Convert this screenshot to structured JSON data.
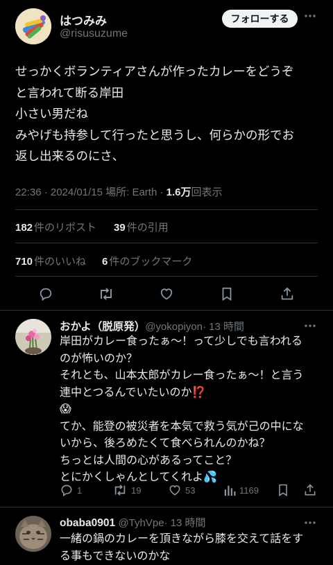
{
  "tweet": {
    "author_name": "はつみみ",
    "author_handle": "@risusuzume",
    "follow_label": "フォローする",
    "text": "せっかくボランティアさんが作ったカレーをどうぞ\nと言われて断る岸田\n小さい男だね\nみやげも持参して行ったと思うし、何らかの形でお\n返し出来るのにさ、",
    "time": "22:36 · 2024/01/15 場所: Earth · ",
    "views_count": "1.6万",
    "views_label": "回表示",
    "reposts_count": "182",
    "reposts_label": "件のリポスト",
    "quotes_count": "39",
    "quotes_label": "件の引用",
    "likes_count": "710",
    "likes_label": "件のいいね",
    "bookmarks_count": "6",
    "bookmarks_label": "件のブックマーク"
  },
  "replies": [
    {
      "name": "おかよ（脱原発）",
      "handle": "@yokopiyon",
      "time": "· 13 時間",
      "text": "岸田がカレー食ったぁ〜！って少しでも言われる\nのが怖いのか？\nそれとも、山本太郎がカレー食ったぁ〜！と言う\n連中とつるんでいたいのか⁉️\n😱\nてか、能登の被災者を本気で救う気が己の中にな\nいから、後ろめたくて食べられんのかね？\nちっとは人間の心があるってこと？\nとにかくしゃんとしてくれよ💦",
      "replies": "1",
      "reposts": "19",
      "likes": "53",
      "views": "1169"
    },
    {
      "name": "obaba0901",
      "handle": "@TyhVpe",
      "time": "· 13 時間",
      "text": "一緒の鍋のカレーを頂きながら膝を交えて話をす\nる事もできないのかな"
    }
  ],
  "icons": {
    "reply": "reply-icon",
    "repost": "repost-icon",
    "like": "heart-icon",
    "bookmark": "bookmark-icon",
    "share": "share-icon",
    "views": "analytics-icon",
    "more": "more-icon"
  },
  "colors": {
    "background": "#000000",
    "text": "#e7e9ea",
    "muted": "#71767b",
    "divider": "#2f3336",
    "button_bg": "#eff3f4"
  }
}
